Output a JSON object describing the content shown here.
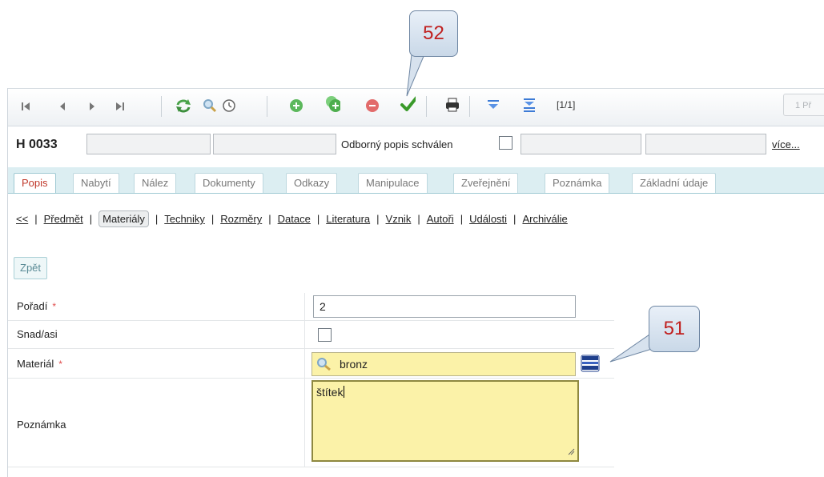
{
  "toolbar": {
    "buttons": [
      {
        "name": "first-record-icon"
      },
      {
        "name": "previous-record-icon"
      },
      {
        "name": "next-record-icon"
      },
      {
        "name": "last-record-icon"
      },
      {
        "name": "refresh-icon"
      },
      {
        "name": "search-icon"
      },
      {
        "name": "history-clock-icon"
      },
      {
        "name": "add-icon"
      },
      {
        "name": "copy-add-icon"
      },
      {
        "name": "delete-icon"
      },
      {
        "name": "save-check-icon"
      },
      {
        "name": "print-icon"
      },
      {
        "name": "filter-icon"
      },
      {
        "name": "filter-advanced-icon"
      }
    ],
    "record_counter": "[1/1]",
    "pager_label": "1 Př"
  },
  "header": {
    "record_id": "H 0033",
    "approved_label": "Odborný popis schválen",
    "approved_checked": false,
    "more_link": "více..."
  },
  "tabs": [
    {
      "label": "Popis",
      "active": true
    },
    {
      "label": "Nabytí",
      "active": false
    },
    {
      "label": "Nález",
      "active": false
    },
    {
      "label": "Dokumenty",
      "active": false
    },
    {
      "label": "Odkazy",
      "active": false
    },
    {
      "label": "Manipulace",
      "active": false
    },
    {
      "label": "Zveřejnění",
      "active": false
    },
    {
      "label": "Poznámka",
      "active": false
    },
    {
      "label": "Základní údaje",
      "active": false
    }
  ],
  "subnav": {
    "back": "<<",
    "items": [
      "Předmět",
      "Materiály",
      "Techniky",
      "Rozměry",
      "Datace",
      "Literatura",
      "Vznik",
      "Autoři",
      "Události",
      "Archiválie"
    ],
    "current": "Materiály"
  },
  "back_button": "Zpět",
  "form": {
    "order": {
      "label": "Pořadí",
      "required_mark": "*",
      "value": "2"
    },
    "maybe": {
      "label": "Snad/asi",
      "checked": false
    },
    "material": {
      "label": "Materiál",
      "required_mark": "*",
      "value": "bronz"
    },
    "note": {
      "label": "Poznámka",
      "value": "štítek"
    }
  },
  "callouts": {
    "toolbar_save": "52",
    "material_list": "51"
  },
  "colors": {
    "tab_active": "#c0392b",
    "field_highlight": "#fbf2a8",
    "callout_number": "#c0201f",
    "tabbar_bg": "#dceef2"
  }
}
